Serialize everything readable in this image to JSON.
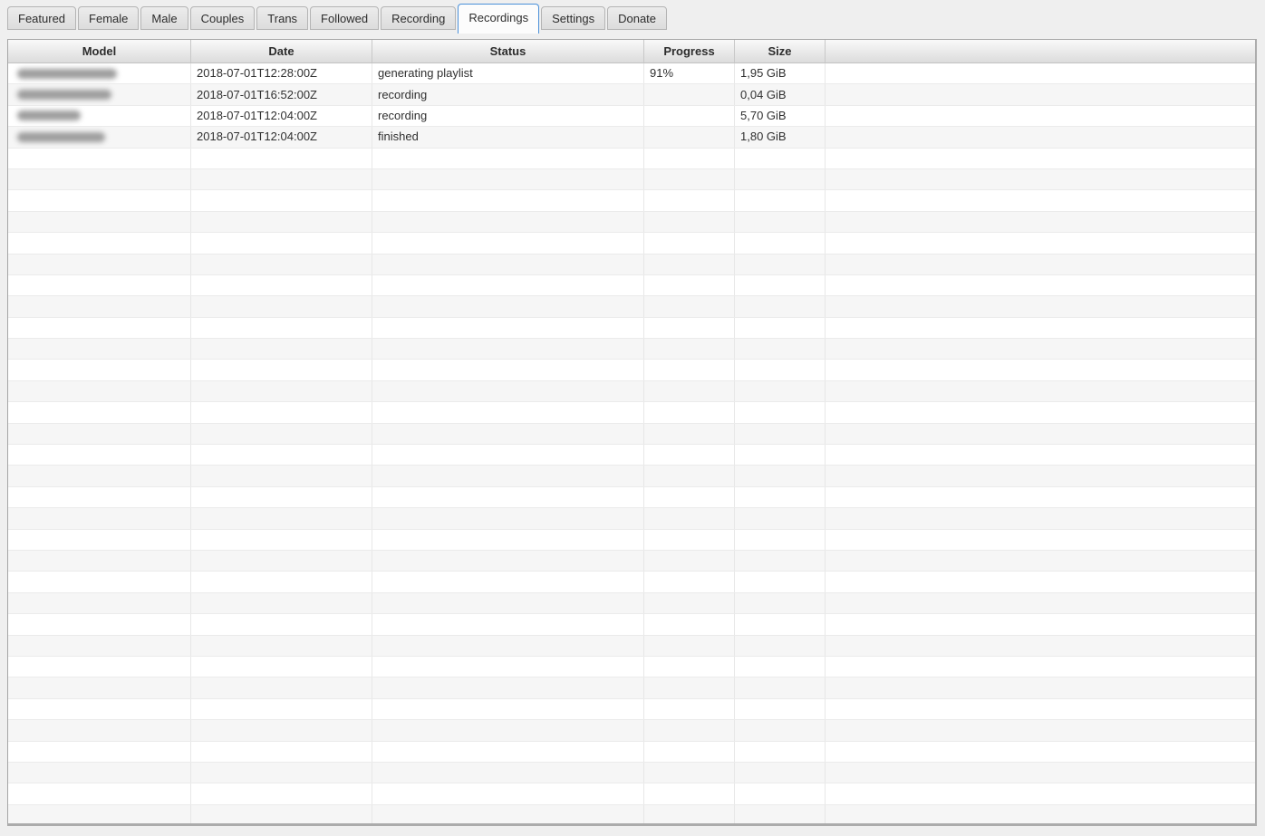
{
  "tab_bar": {
    "tabs": [
      {
        "label": "Featured",
        "active": false
      },
      {
        "label": "Female",
        "active": false
      },
      {
        "label": "Male",
        "active": false
      },
      {
        "label": "Couples",
        "active": false
      },
      {
        "label": "Trans",
        "active": false
      },
      {
        "label": "Followed",
        "active": false
      },
      {
        "label": "Recording",
        "active": false
      },
      {
        "label": "Recordings",
        "active": true
      },
      {
        "label": "Settings",
        "active": false
      },
      {
        "label": "Donate",
        "active": false
      }
    ],
    "active_tab_border_color": "#4a90d9"
  },
  "recordings_table": {
    "columns": [
      {
        "label": "Model"
      },
      {
        "label": "Date"
      },
      {
        "label": "Status"
      },
      {
        "label": "Progress"
      },
      {
        "label": "Size"
      },
      {
        "label": ""
      }
    ],
    "rows": [
      {
        "model_redacted": true,
        "model_blur_width": 110,
        "date": "2018-07-01T12:28:00Z",
        "status": "generating playlist",
        "progress": "91%",
        "size": "1,95 GiB"
      },
      {
        "model_redacted": true,
        "model_blur_width": 104,
        "date": "2018-07-01T16:52:00Z",
        "status": "recording",
        "progress": "",
        "size": "0,04 GiB"
      },
      {
        "model_redacted": true,
        "model_blur_width": 70,
        "date": "2018-07-01T12:04:00Z",
        "status": "recording",
        "progress": "",
        "size": "5,70 GiB"
      },
      {
        "model_redacted": true,
        "model_blur_width": 97,
        "date": "2018-07-01T12:04:00Z",
        "status": "finished",
        "progress": "",
        "size": "1,80 GiB"
      }
    ],
    "empty_rows": 32,
    "stripe_color": "#f6f6f6"
  }
}
